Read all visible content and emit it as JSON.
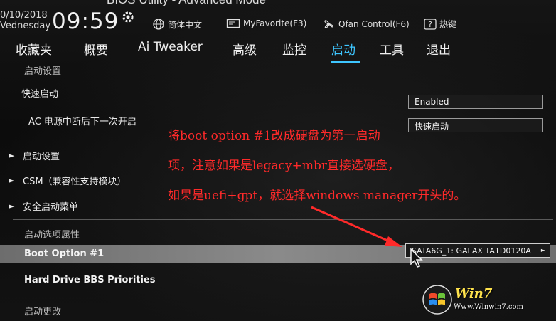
{
  "header": {
    "title": "BIOS Utility - Advanced Mode",
    "date": "0/10/2018",
    "weekday": "Vednesday",
    "time": "09:59",
    "items": [
      {
        "icon": "globe-icon",
        "label": "简体中文"
      },
      {
        "icon": "favorite-icon",
        "label": "MyFavorite(F3)"
      },
      {
        "icon": "fan-icon",
        "label": "Qfan Control(F6)"
      },
      {
        "icon": "help-icon",
        "label": "热键"
      }
    ]
  },
  "tabs": [
    "收藏夹",
    "概要",
    "Ai Tweaker",
    "高级",
    "监控",
    "启动",
    "工具",
    "退出"
  ],
  "active_tab": "启动",
  "rows": {
    "boot_settings_header": "启动设置",
    "fast_boot": "快速启动",
    "fast_boot_value": "Enabled",
    "ac_power": "AC 电源中断后下一次开启",
    "ac_power_value": "快速启动",
    "boot_config": "启动设置",
    "csm": "CSM（兼容性支持模块）",
    "secure_boot": "安全启动菜单",
    "boot_option_priorities": "启动选项属性",
    "boot_option_1": "Boot Option #1",
    "boot_option_1_value": "SATA6G_1: GALAX TA1D0120A",
    "hdd_bbs": "Hard Drive BBS Priorities",
    "boot_override": "启动更改"
  },
  "annotation": [
    "将boot option #1改成硬盘为第一启动",
    "项，注意如果是legacy+mbr直接选硬盘，",
    "如果是uefi+gpt，就选择windows manager开头的。"
  ],
  "watermark": {
    "brand": "Win7",
    "url": "Www.Winwin7.com"
  },
  "colors": {
    "active_tab": "#3ec6ff",
    "annotation": "#ff2a2a",
    "watermark_brand": "#ffe34d"
  }
}
